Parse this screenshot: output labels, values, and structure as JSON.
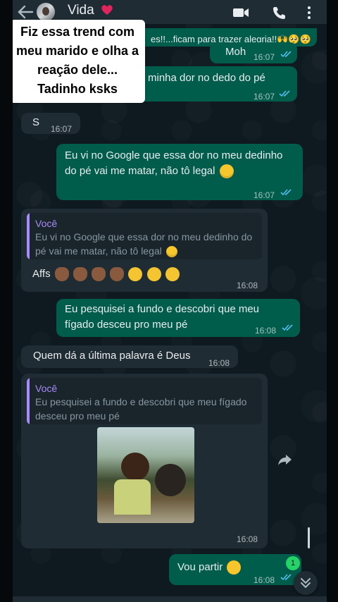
{
  "header": {
    "contact_name": "Vida"
  },
  "hidden_bubble": {
    "visible_text": "es!!...ficam para trazer alegria!!🙌🥺🥺"
  },
  "overlay_caption": {
    "line1": "Fiz essa trend com",
    "line2": "meu marido e olha a",
    "line3": "reação dele...",
    "line4": "Tadinho ksks"
  },
  "messages": {
    "m1": {
      "text": "Moh",
      "time": "16:07"
    },
    "m2": {
      "text": "minha dor no dedo do pé",
      "time": "16:07"
    },
    "m3": {
      "text": "S",
      "time": "16:07"
    },
    "m4": {
      "text": "Eu vi no Google que essa dor no meu dedinho do pé vai me matar, não tô legal",
      "time": "16:07"
    },
    "m5": {
      "quote_author": "Você",
      "quote_text": "Eu vi no Google que essa dor no meu dedinho do pé vai me matar, não tô legal",
      "text": "Affs",
      "time": "16:08"
    },
    "m6": {
      "text": "Eu pesquisei a fundo e descobri que meu fígado desceu pro meu pé",
      "time": "16:08"
    },
    "m7": {
      "text": "Quem dá a última palavra é Deus",
      "time": "16:08"
    },
    "m8": {
      "quote_author": "Você",
      "quote_text": "Eu pesquisei a fundo e descobri que meu fígado desceu pro meu pé",
      "time": "16:08"
    },
    "m9": {
      "text": "Vou partir",
      "time": "16:08"
    }
  },
  "unread_badge": "1",
  "icons": {
    "back": "arrow-left-icon",
    "video": "video-camera-icon",
    "call": "phone-icon",
    "menu": "more-vertical-icon",
    "share": "forward-icon",
    "scroll": "chevron-double-down-icon"
  },
  "colors": {
    "outgoing_bubble": "#005c4b",
    "incoming_bubble": "#202c33",
    "header": "#1f2c33",
    "quote_accent": "#a78bfa",
    "read_ticks": "#53bdeb",
    "badge": "#25d366"
  }
}
